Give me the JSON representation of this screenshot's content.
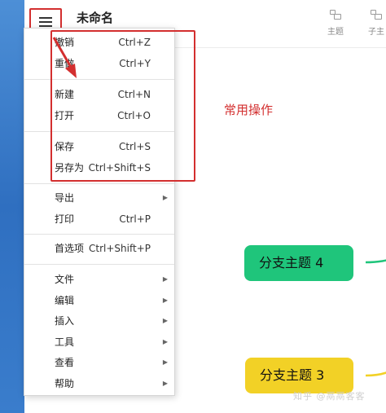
{
  "header": {
    "doc_title": "未命名",
    "toolbar": [
      {
        "label": "主题",
        "icon": "topic-icon"
      },
      {
        "label": "子主",
        "icon": "subtopic-icon"
      }
    ]
  },
  "menu": {
    "groups": [
      [
        {
          "label": "撤销",
          "shortcut": "Ctrl+Z"
        },
        {
          "label": "重做",
          "shortcut": "Ctrl+Y"
        }
      ],
      [
        {
          "label": "新建",
          "shortcut": "Ctrl+N"
        },
        {
          "label": "打开",
          "shortcut": "Ctrl+O"
        }
      ],
      [
        {
          "label": "保存",
          "shortcut": "Ctrl+S"
        },
        {
          "label": "另存为",
          "shortcut": "Ctrl+Shift+S"
        }
      ],
      [
        {
          "label": "导出",
          "submenu": true
        },
        {
          "label": "打印",
          "shortcut": "Ctrl+P"
        }
      ],
      [
        {
          "label": "首选项",
          "shortcut": "Ctrl+Shift+P"
        }
      ],
      [
        {
          "label": "文件",
          "submenu": true
        },
        {
          "label": "编辑",
          "submenu": true
        },
        {
          "label": "插入",
          "submenu": true
        },
        {
          "label": "工具",
          "submenu": true
        },
        {
          "label": "查看",
          "submenu": true
        },
        {
          "label": "帮助",
          "submenu": true
        }
      ]
    ]
  },
  "annotation": {
    "text": "常用操作",
    "color": "#d32f2f"
  },
  "nodes": [
    {
      "label": "分支主题 4",
      "color": "#1fc57b"
    },
    {
      "label": "分支主题 3",
      "color": "#f2d126"
    }
  ],
  "watermark": "知乎 @鬲鬲客客"
}
